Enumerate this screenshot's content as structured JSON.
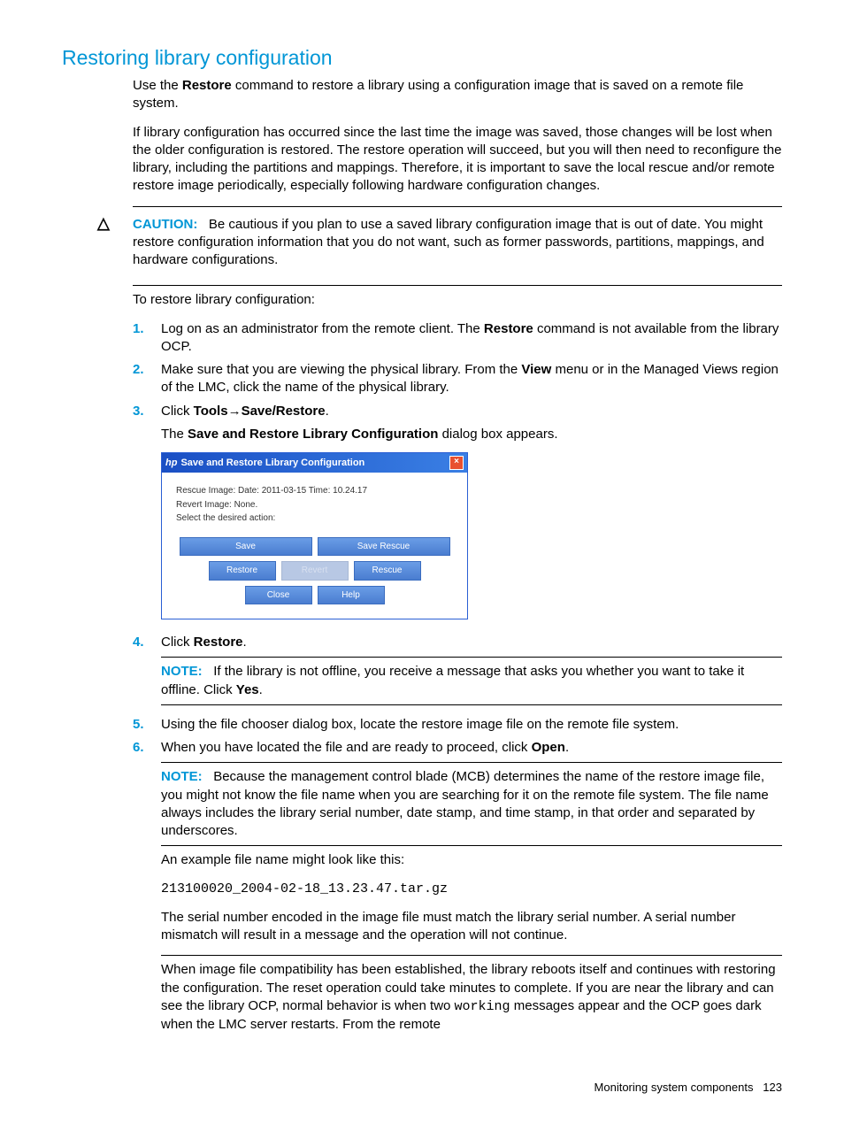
{
  "title": "Restoring library configuration",
  "intro": {
    "p1a": "Use the ",
    "p1b": "Restore",
    "p1c": " command to restore a library using a configuration image that is saved on a remote file system.",
    "p2": "If library configuration has occurred since the last time the image was saved, those changes will be lost when the older configuration is restored. The restore operation will succeed, but you will then need to reconfigure the library, including the partitions and mappings. Therefore, it is important to save the local rescue and/or remote restore image periodically, especially following hardware configuration changes."
  },
  "caution": {
    "label": "CAUTION:",
    "text": "Be cautious if you plan to use a saved library configuration image that is out of date. You might restore configuration information that you do not want, such as former passwords, partitions, mappings, and hardware configurations."
  },
  "lead": "To restore library configuration:",
  "steps": {
    "s1": {
      "num": "1.",
      "a": "Log on as an administrator from the remote client. The ",
      "b": "Restore",
      "c": " command is not available from the library OCP."
    },
    "s2": {
      "num": "2.",
      "a": "Make sure that you are viewing the physical library. From the ",
      "b": "View",
      "c": " menu or in the Managed Views region of the LMC, click the name of the physical library."
    },
    "s3": {
      "num": "3.",
      "a": "Click ",
      "tools": "Tools",
      "arrow": "→",
      "saverestore": "Save/Restore",
      "dot": ".",
      "followA": "The ",
      "followB": "Save and Restore Library Configuration",
      "followC": " dialog box appears."
    },
    "s4": {
      "num": "4.",
      "a": "Click ",
      "b": "Restore",
      "c": "."
    },
    "note1": {
      "label": "NOTE:",
      "a": "If the library is not offline, you receive a message that asks you whether you want to take it offline. Click ",
      "b": "Yes",
      "c": "."
    },
    "s5": {
      "num": "5.",
      "text": "Using the file chooser dialog box, locate the restore image file on the remote file system."
    },
    "s6": {
      "num": "6.",
      "a": "When you have located the file and are ready to proceed, click ",
      "b": "Open",
      "c": "."
    },
    "note2": {
      "label": "NOTE:",
      "text": "Because the management control blade (MCB) determines the name of the restore image file, you might not know the file name when you are searching for it on the remote file system. The file name always includes the library serial number, date stamp, and time stamp, in that order and separated by underscores."
    },
    "example_lead": "An example file name might look like this:",
    "example_file": "213100020_2004-02-18_13.23.47.tar.gz",
    "serial_text": "The serial number encoded in the image file must match the library serial number. A serial number mismatch will result in a message and the operation will not continue.",
    "final_a": "When image file compatibility has been established, the library reboots itself and continues with restoring the configuration. The reset operation could take minutes to complete. If you are near the library and can see the library OCP, normal behavior is when two ",
    "final_b": "working",
    "final_c": " messages appear and the OCP goes dark when the LMC server restarts. From the remote"
  },
  "dialog": {
    "title": "Save and Restore Library Configuration",
    "line1": "Rescue Image: Date: 2011-03-15 Time: 10.24.17",
    "line2": "Revert Image: None.",
    "line3": "Select the desired action:",
    "buttons": {
      "save": "Save",
      "save_rescue": "Save Rescue",
      "restore": "Restore",
      "revert": "Revert",
      "rescue": "Rescue",
      "close": "Close",
      "help": "Help"
    }
  },
  "footer": {
    "text": "Monitoring system components",
    "page": "123"
  }
}
